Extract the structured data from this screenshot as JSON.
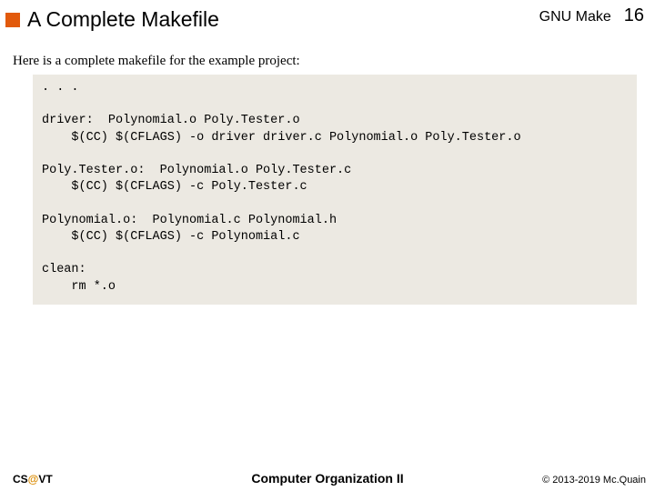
{
  "header": {
    "title": "A Complete Makefile",
    "topic": "GNU Make",
    "page": "16"
  },
  "intro": "Here is a complete makefile for the example project:",
  "code": ". . .\n\ndriver:  Polynomial.o Poly.Tester.o\n    $(CC) $(CFLAGS) -o driver driver.c Polynomial.o Poly.Tester.o\n\nPoly.Tester.o:  Polynomial.o Poly.Tester.c\n    $(CC) $(CFLAGS) -c Poly.Tester.c\n\nPolynomial.o:  Polynomial.c Polynomial.h\n    $(CC) $(CFLAGS) -c Polynomial.c\n\nclean:\n    rm *.o",
  "footer": {
    "left_prefix": "CS",
    "left_at": "@",
    "left_suffix": "VT",
    "center": "Computer Organization II",
    "right": "© 2013-2019 Mc.Quain"
  }
}
